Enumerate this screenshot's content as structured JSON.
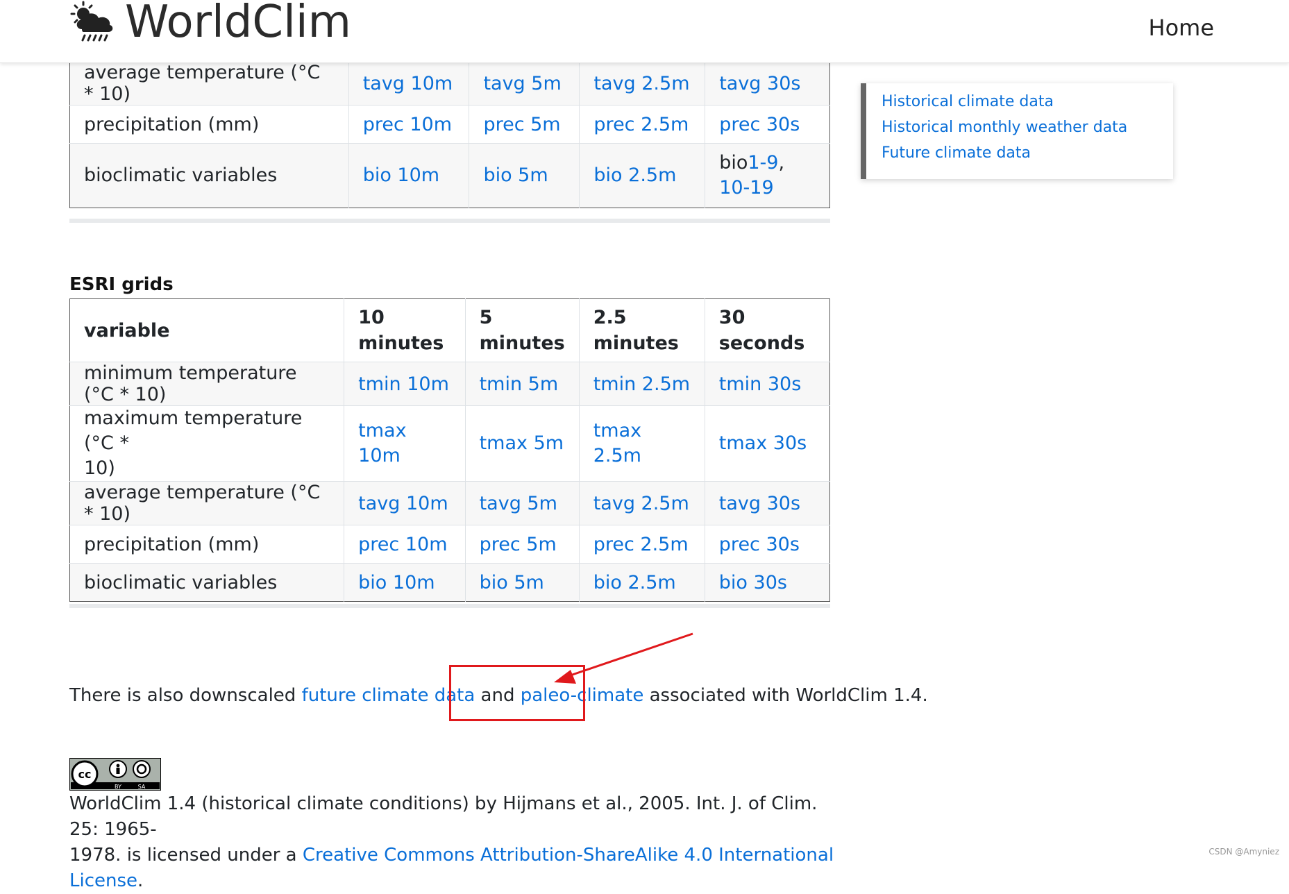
{
  "header": {
    "site_title": "WorldClim",
    "nav_home": "Home"
  },
  "top_table": {
    "rows": [
      {
        "variable": "average temperature (°C * 10)",
        "links": [
          "tavg 10m",
          "tavg 5m",
          "tavg 2.5m",
          "tavg 30s"
        ]
      },
      {
        "variable": "precipitation (mm)",
        "links": [
          "prec 10m",
          "prec 5m",
          "prec 2.5m",
          "prec 30s"
        ]
      },
      {
        "variable": "bioclimatic variables",
        "links": [
          "bio 10m",
          "bio 5m",
          "bio 2.5m"
        ],
        "last_prefix": "bio",
        "last_link_a": "1-9",
        "last_sep": ",",
        "last_link_b": "10-19"
      }
    ]
  },
  "esri": {
    "title": "ESRI grids",
    "headers": {
      "variable": "variable",
      "c10_num": "10",
      "c10_unit": "minutes",
      "c5_num": "5",
      "c5_unit": "minutes",
      "c25_num": "2.5",
      "c25_unit": "minutes",
      "c30_num": "30",
      "c30_unit": "seconds"
    },
    "rows": [
      {
        "variable": "minimum temperature (°C * 10)",
        "links": [
          "tmin 10m",
          "tmin 5m",
          "tmin 2.5m",
          "tmin 30s"
        ]
      },
      {
        "variable_line1": "maximum temperature (°C *",
        "variable_line2": "10)",
        "links": [
          "tmax 10m",
          "tmax 5m",
          "tmax 2.5m",
          "tmax 30s"
        ]
      },
      {
        "variable": "average temperature (°C * 10)",
        "links": [
          "tavg 10m",
          "tavg 5m",
          "tavg 2.5m",
          "tavg 30s"
        ]
      },
      {
        "variable": "precipitation (mm)",
        "links": [
          "prec 10m",
          "prec 5m",
          "prec 2.5m",
          "prec 30s"
        ]
      },
      {
        "variable": "bioclimatic variables",
        "links": [
          "bio 10m",
          "bio 5m",
          "bio 2.5m",
          "bio 30s"
        ]
      }
    ]
  },
  "sidebar": {
    "items": [
      "Historical climate data",
      "Historical monthly weather data",
      "Future climate data"
    ]
  },
  "paragraph": {
    "prefix": "There is also downscaled ",
    "link1": "future climate data",
    "middle": " and ",
    "link2": "paleo-climate",
    "suffix": " associated with WorldClim 1.4."
  },
  "license": {
    "badge_by": "BY",
    "badge_sa": "SA",
    "text_line1": "WorldClim 1.4 (historical climate conditions) by Hijmans et al., 2005. Int. J. of Clim. 25: 1965-",
    "text_line2": "1978. is licensed under a ",
    "link": "Creative Commons Attribution-ShareAlike 4.0 International License",
    "end": "."
  },
  "watermark": "CSDN @Amyniez",
  "colors": {
    "link": "#0a6fd8",
    "annotation": "#e0191c"
  },
  "icons": {
    "logo": "sun-cloud-rain-icon",
    "badge": "cc-by-sa-icon"
  }
}
